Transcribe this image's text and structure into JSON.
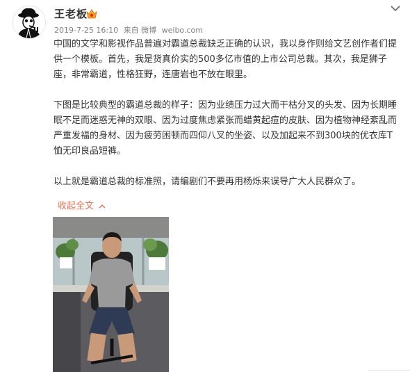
{
  "post": {
    "user": {
      "name": "王老板",
      "avatar_icon": "sherlock-avatar-icon",
      "badge_icon": "vip-badge-icon"
    },
    "meta": {
      "datetime": "2019-7-25 16:10",
      "via_label": "来自 微博",
      "source": "weibo.com"
    },
    "content": {
      "paragraphs": [
        "中国的文学和影视作品普遍对霸道总裁缺乏正确的认识，我以身作则给文艺创作者们提供一个模板。首先，我是货真价实的500多亿市值的上市公司总裁。其次，我是狮子座，非常霸道，性格狂野，连唐岩也不放在眼里。",
        "下图是比较典型的霸道总裁的样子：因为业绩压力过大而干枯分叉的头发、因为长期睡眠不足而迷惑无神的双眼、因为过度焦虑紧张而蜡黄起痘的皮肤、因为植物神经紊乱而严重发福的身材、因为疲劳困顿而四仰八叉的坐姿、以及加起来不到300块的优衣库T恤无印良品短裤。",
        "以上就是霸道总裁的标准照，请编剧们不要再用杨烁来误导广大人民群众了。"
      ]
    },
    "collapse_label": "收起全文",
    "colors": {
      "link": "#eb7350",
      "meta_gray": "#808080",
      "text": "#333333"
    }
  }
}
